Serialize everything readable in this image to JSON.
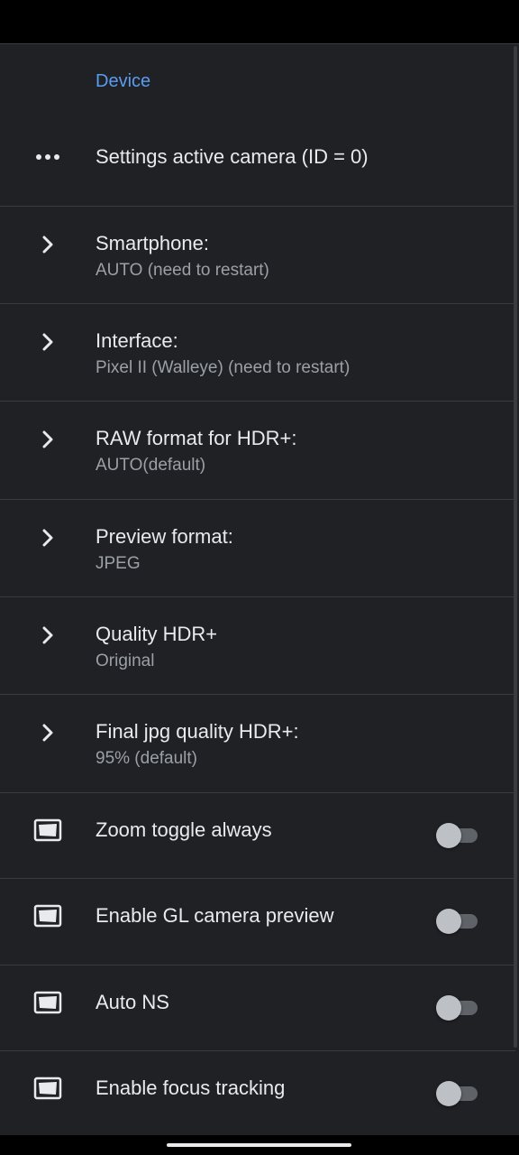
{
  "section": {
    "header": "Device"
  },
  "rows": [
    {
      "title": "Settings active camera (ID = 0)",
      "icon": "more-horizontal-icon"
    },
    {
      "title": "Smartphone:",
      "summary": "AUTO (need to restart)",
      "icon": "chevron-right-icon"
    },
    {
      "title": "Interface:",
      "summary": "Pixel II (Walleye) (need to restart)",
      "icon": "chevron-right-icon"
    },
    {
      "title": "RAW format for HDR+:",
      "summary": "AUTO(default)",
      "icon": "chevron-right-icon"
    },
    {
      "title": "Preview format:",
      "summary": "JPEG",
      "icon": "chevron-right-icon"
    },
    {
      "title": "Quality HDR+",
      "summary": "Original",
      "icon": "chevron-right-icon"
    },
    {
      "title": "Final jpg quality HDR+:",
      "summary": "95% (default)",
      "icon": "chevron-right-icon"
    },
    {
      "title": "Zoom toggle always",
      "icon": "photo-frame-icon",
      "toggle_on": false
    },
    {
      "title": "Enable GL camera preview",
      "icon": "photo-frame-icon",
      "toggle_on": false
    },
    {
      "title": "Auto NS",
      "icon": "photo-frame-icon",
      "toggle_on": false
    },
    {
      "title": "Enable focus tracking",
      "icon": "photo-frame-icon",
      "toggle_on": false
    }
  ],
  "colors": {
    "background": "#202124",
    "accent": "#5b9cf0",
    "title_text": "#e8eaed",
    "summary_text": "#9aa0a6"
  }
}
